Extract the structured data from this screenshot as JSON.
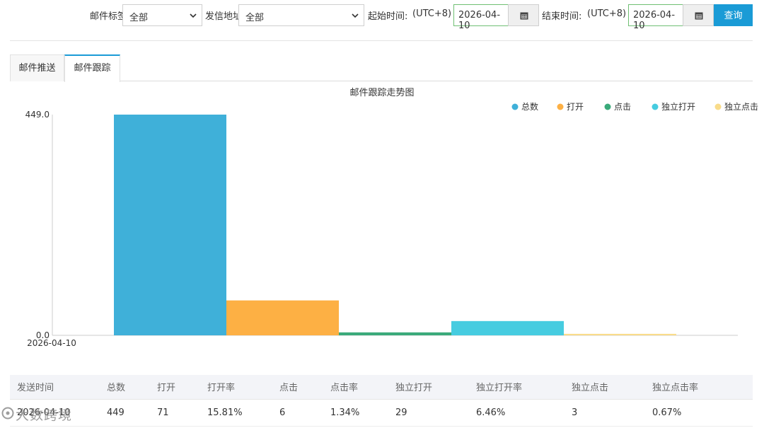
{
  "filters": {
    "tag_label": "邮件标签",
    "tag_value": "全部",
    "sender_label": "发信地址",
    "sender_value": "全部",
    "start_label": "起始时间:",
    "start_tz": "(UTC+8)",
    "start_date": "2026-04-10",
    "end_label": "结束时间:",
    "end_tz": "(UTC+8)",
    "end_date": "2026-04-10",
    "search_label": "查询"
  },
  "tabs": [
    {
      "label": "邮件推送",
      "active": false
    },
    {
      "label": "邮件跟踪",
      "active": true
    }
  ],
  "chart_data": {
    "type": "bar",
    "title": "邮件跟踪走势图",
    "categories": [
      "2026-04-10"
    ],
    "series": [
      {
        "name": "总数",
        "values": [
          449
        ],
        "color": "#3fb0d9"
      },
      {
        "name": "打开",
        "values": [
          71
        ],
        "color": "#fdb044"
      },
      {
        "name": "点击",
        "values": [
          6
        ],
        "color": "#3aaa7a"
      },
      {
        "name": "独立打开",
        "values": [
          29
        ],
        "color": "#46cce0"
      },
      {
        "name": "独立点击",
        "values": [
          3
        ],
        "color": "#f9dc8a"
      }
    ],
    "ylim": [
      0,
      449
    ],
    "y_ticks": [
      "449.0",
      "0.0"
    ],
    "legend_position": "top-right",
    "grid": false
  },
  "table": {
    "headers": [
      "发送时间",
      "总数",
      "打开",
      "打开率",
      "点击",
      "点击率",
      "独立打开",
      "独立打开率",
      "独立点击",
      "独立点击率"
    ],
    "rows": [
      [
        "2026-04-10",
        "449",
        "71",
        "15.81%",
        "6",
        "1.34%",
        "29",
        "6.46%",
        "3",
        "0.67%"
      ]
    ]
  },
  "watermark": "大数跨境"
}
